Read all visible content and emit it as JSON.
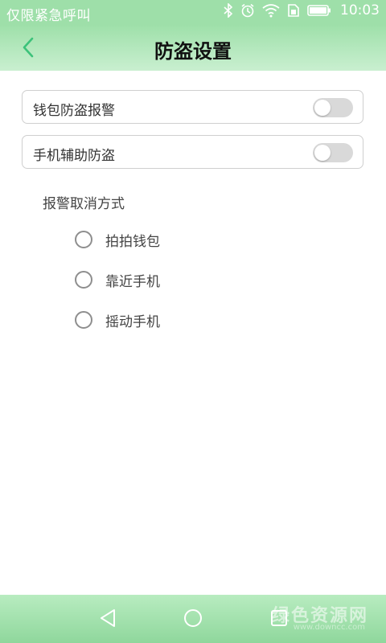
{
  "status_bar": {
    "carrier": "仅限紧急呼叫",
    "time": "10:03",
    "icons": [
      "bluetooth-icon",
      "alarm-icon",
      "wifi-icon",
      "sim-icon",
      "battery-icon"
    ]
  },
  "header": {
    "title": "防盗设置",
    "back_icon": "chevron-left-icon"
  },
  "settings": [
    {
      "label": "钱包防盗报警",
      "enabled": false
    },
    {
      "label": "手机辅助防盗",
      "enabled": false
    }
  ],
  "alarm_cancel": {
    "title": "报警取消方式",
    "options": [
      {
        "label": "拍拍钱包",
        "selected": false
      },
      {
        "label": "靠近手机",
        "selected": false
      },
      {
        "label": "摇动手机",
        "selected": false
      }
    ]
  },
  "nav_bar": {
    "icons": [
      "back-triangle-icon",
      "home-circle-icon",
      "recents-square-icon"
    ]
  },
  "watermark": {
    "text": "绿色资源网",
    "sub": "www.downcc.com"
  },
  "colors": {
    "header": "#9fe0aa",
    "accent": "#3cc27a",
    "toggle_off": "#d9d9d9"
  }
}
